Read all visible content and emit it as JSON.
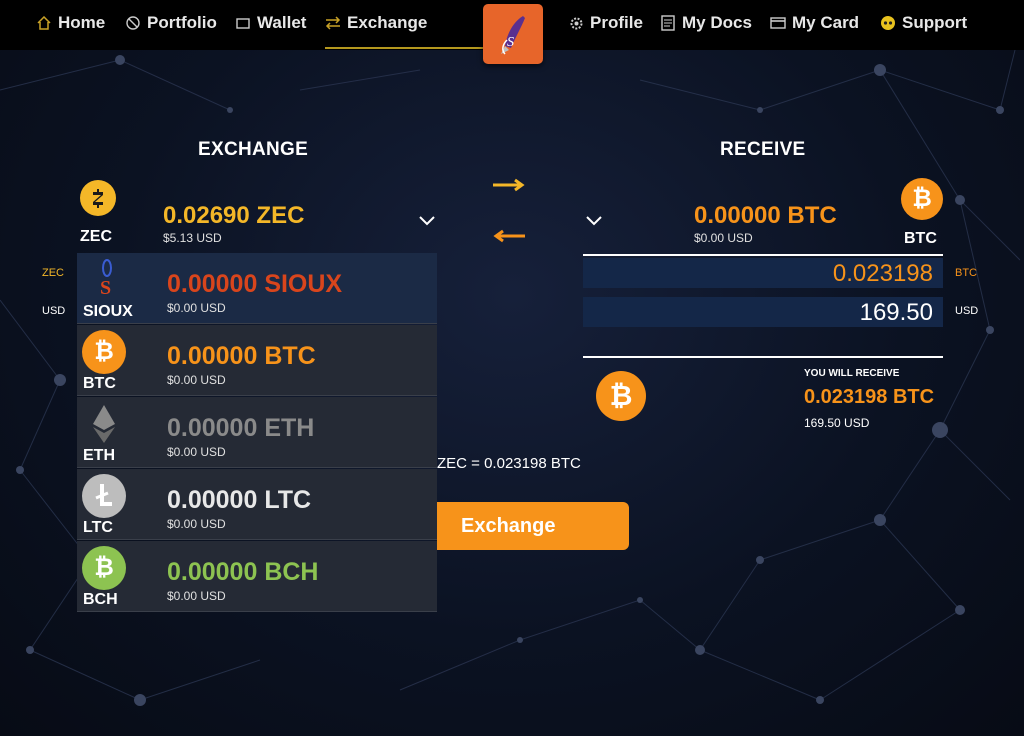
{
  "nav": {
    "home": "Home",
    "portfolio": "Portfolio",
    "wallet": "Wallet",
    "exchange": "Exchange",
    "profile": "Profile",
    "my_docs": "My Docs",
    "my_card": "My Card",
    "support": "Support",
    "logo_letter": "S"
  },
  "exchange": {
    "heading": "EXCHANGE",
    "coin": "ZEC",
    "amount": "0.02690 ZEC",
    "usd": "$5.13 USD",
    "side_label_coin": "ZEC",
    "side_label_usd": "USD"
  },
  "receive": {
    "heading": "RECEIVE",
    "coin": "BTC",
    "amount": "0.00000 BTC",
    "usd": "$0.00 USD",
    "field_btc_value": "0.023198",
    "field_btc_label": "BTC",
    "field_usd_value": "169.50",
    "field_usd_label": "USD",
    "you_will_receive_label": "YOU WILL RECEIVE",
    "you_will_receive_amount": "0.023198 BTC",
    "you_will_receive_usd": "169.50 USD"
  },
  "dropdown": [
    {
      "symbol": "SIOUX",
      "amount": "0.00000 SIOUX",
      "usd": "$0.00 USD",
      "color": "#d9451c"
    },
    {
      "symbol": "BTC",
      "amount": "0.00000 BTC",
      "usd": "$0.00 USD",
      "color": "#f7931a"
    },
    {
      "symbol": "ETH",
      "amount": "0.00000 ETH",
      "usd": "$0.00 USD",
      "color": "#8a8a8a"
    },
    {
      "symbol": "LTC",
      "amount": "0.00000 LTC",
      "usd": "$0.00 USD",
      "color": "#e8e8e8"
    },
    {
      "symbol": "BCH",
      "amount": "0.00000 BCH",
      "usd": "$0.00 USD",
      "color": "#8dc351"
    }
  ],
  "rate_text": "ZEC = 0.023198 BTC",
  "exchange_button": "Exchange",
  "colors": {
    "accent": "#f7931a",
    "zec": "#f4b728",
    "btc": "#f7931a",
    "sioux": "#d9451c",
    "bch": "#8dc351",
    "field_bg": "#142748"
  }
}
